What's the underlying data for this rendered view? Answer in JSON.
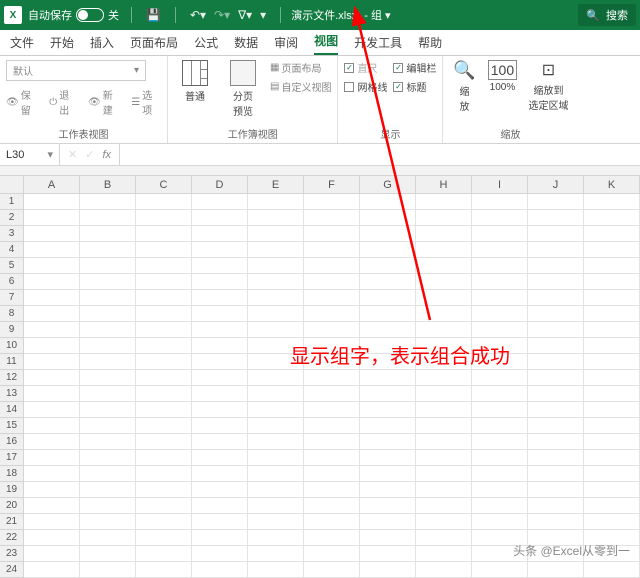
{
  "titlebar": {
    "autosave_label": "自动保存",
    "autosave_state": "关",
    "filename": "演示文件.xlsx",
    "group_suffix": "- 组 ▾",
    "search_label": "搜索"
  },
  "tabs": [
    "文件",
    "开始",
    "插入",
    "页面布局",
    "公式",
    "数据",
    "审阅",
    "视图",
    "开发工具",
    "帮助"
  ],
  "active_tab": "视图",
  "ribbon": {
    "group1": {
      "default_label": "默认",
      "buttons": [
        "保留",
        "退出",
        "新建",
        "选项"
      ],
      "label": "工作表视图"
    },
    "group2": {
      "btn1": "普通",
      "btn2": "分页\n预览",
      "btn3": "页面布局",
      "btn4": "自定义视图",
      "label": "工作簿视图"
    },
    "group3": {
      "c1": "直尺",
      "c2": "编辑栏",
      "c3": "网格线",
      "c4": "标题",
      "label": "显示"
    },
    "group4": {
      "btn1": "缩\n放",
      "btn2": "100%",
      "btn3": "缩放到\n选定区域",
      "label": "缩放"
    }
  },
  "formula": {
    "name_box": "L30",
    "fx": "fx"
  },
  "columns": [
    "A",
    "B",
    "C",
    "D",
    "E",
    "F",
    "G",
    "H",
    "I",
    "J",
    "K"
  ],
  "row_count": 24,
  "annotation_text": "显示组字，表示组合成功",
  "watermark": "头条 @Excel从零到一"
}
